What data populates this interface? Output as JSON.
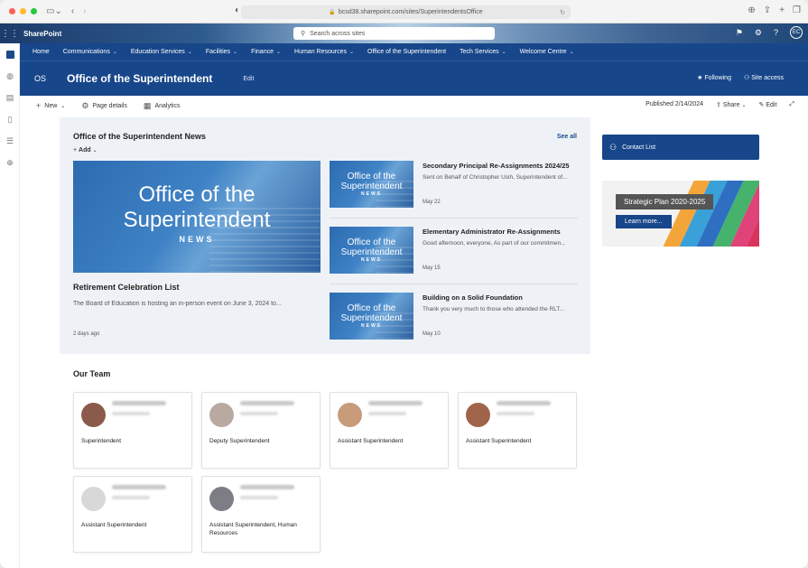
{
  "browser": {
    "url": "bcsd38.sharepoint.com/sites/SuperintendentsOffice"
  },
  "suite": {
    "app_name": "SharePoint",
    "search_placeholder": "Search across sites",
    "user_initials": "EC"
  },
  "nav": {
    "items": [
      {
        "label": "Home",
        "dropdown": false
      },
      {
        "label": "Communications",
        "dropdown": true
      },
      {
        "label": "Education Services",
        "dropdown": true
      },
      {
        "label": "Facilities",
        "dropdown": true
      },
      {
        "label": "Finance",
        "dropdown": true
      },
      {
        "label": "Human Resources",
        "dropdown": true
      },
      {
        "label": "Office of the Superintendent",
        "dropdown": false
      },
      {
        "label": "Tech Services",
        "dropdown": true
      },
      {
        "label": "Welcome Centre",
        "dropdown": true
      }
    ]
  },
  "site": {
    "logo_text": "OS",
    "title": "Office of the Superintendent",
    "edit_label": "Edit",
    "following_label": "Following",
    "access_label": "Site access"
  },
  "commands": {
    "new_label": "New",
    "page_details_label": "Page details",
    "analytics_label": "Analytics",
    "published": "Published 2/14/2024",
    "share_label": "Share",
    "edit_label": "Edit"
  },
  "news": {
    "title": "Office of the Superintendent News",
    "see_all": "See all",
    "add_label": "Add",
    "image_line1": "Office of the",
    "image_line2": "Superintendent",
    "image_line3": "NEWS",
    "hero": {
      "headline": "Retirement Celebration List",
      "summary": "The Board of Education is hosting an in-person event on June 3, 2024 to...",
      "date": "2 days ago"
    },
    "items": [
      {
        "headline": "Secondary Principal Re-Assignments 2024/25",
        "summary": "Sent on Behalf of Christopher Usih, Superintendent of...",
        "date": "May 22"
      },
      {
        "headline": "Elementary Administrator Re-Assignments",
        "summary": "Good afternoon, everyone, As part of our commitmen...",
        "date": "May 15"
      },
      {
        "headline": "Building on a Solid Foundation",
        "summary": "Thank you very much to those who attended the RLT...",
        "date": "May 10"
      }
    ]
  },
  "side": {
    "contact_label": "Contact List",
    "strategic_label": "Strategic Plan 2020-2025",
    "learn_more": "Learn more..."
  },
  "team": {
    "title": "Our Team",
    "members": [
      {
        "title": "Superintendent",
        "photo_color": "#8a5a4a"
      },
      {
        "title": "Deputy Superintendent",
        "photo_color": "#b9a9a0"
      },
      {
        "title": "Assistant Superintendent",
        "photo_color": "#c89b7b"
      },
      {
        "title": "Assistant Superintendent",
        "photo_color": "#a0644a"
      },
      {
        "title": "Assistant Superintendent",
        "photo_color": "#d8d8d8"
      },
      {
        "title": "Assistant Superintendent, Human Resources",
        "photo_color": "#7d7d86"
      }
    ]
  },
  "colors": {
    "brand": "#17468a",
    "panel": "#eef2f6"
  }
}
